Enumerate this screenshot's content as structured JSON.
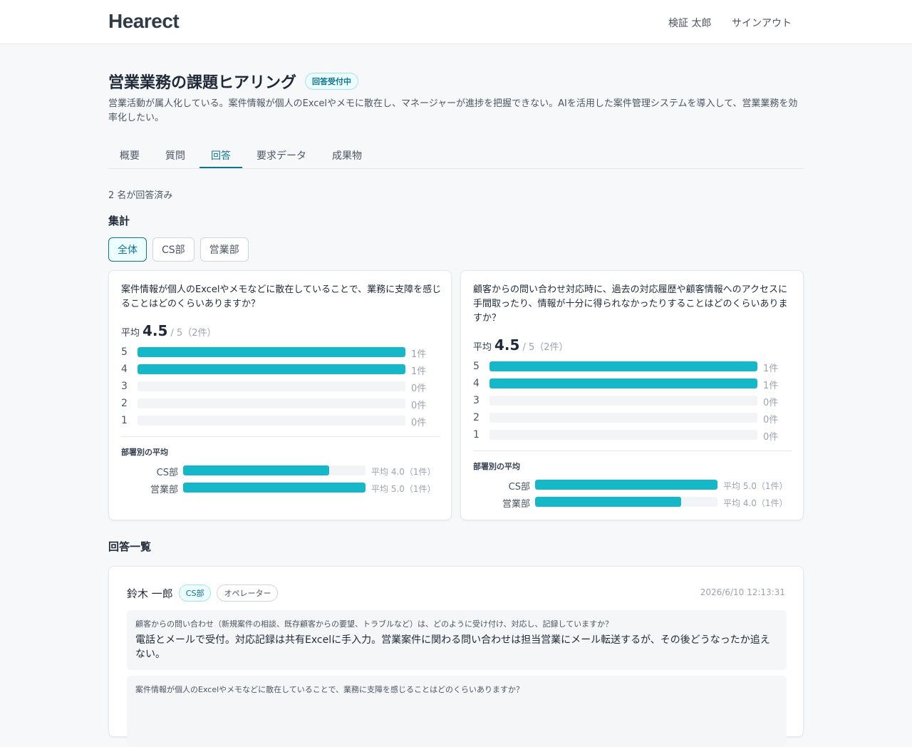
{
  "header": {
    "logo": "Hearect",
    "user_name": "検証 太郎",
    "signout_label": "サインアウト"
  },
  "project": {
    "title": "営業業務の課題ヒアリング",
    "status": "回答受付中",
    "description": "営業活動が属人化している。案件情報が個人のExcelやメモに散在し、マネージャーが進捗を把握できない。AIを活用した案件管理システムを導入して、営業業務を効率化したい。"
  },
  "tabs": [
    {
      "label": "概要"
    },
    {
      "label": "質問"
    },
    {
      "label": "回答",
      "active": true
    },
    {
      "label": "要求データ"
    },
    {
      "label": "成果物"
    }
  ],
  "respondent_count": "2 名が回答済み",
  "summary": {
    "heading": "集計",
    "filters": [
      {
        "label": "全体",
        "active": true
      },
      {
        "label": "CS部"
      },
      {
        "label": "営業部"
      }
    ]
  },
  "accent_color": "#14b8c8",
  "chart_data": [
    {
      "type": "bar",
      "title": "案件情報が個人のExcelやメモなどに散在していることで、業務に支障を感じることはどのくらいありますか？",
      "avg_label": "平均",
      "avg_value": "4.5",
      "avg_suffix": "/ 5（2件）",
      "categories": [
        "5",
        "4",
        "3",
        "2",
        "1"
      ],
      "values": [
        1,
        1,
        0,
        0,
        0
      ],
      "count_labels": [
        "1件",
        "1件",
        "0件",
        "0件",
        "0件"
      ],
      "max": 1,
      "dept_title": "部署別の平均",
      "dept": [
        {
          "name": "CS部",
          "avg": 4.0,
          "label": "平均 4.0（1件）"
        },
        {
          "name": "営業部",
          "avg": 5.0,
          "label": "平均 5.0（1件）"
        }
      ]
    },
    {
      "type": "bar",
      "title": "顧客からの問い合わせ対応時に、過去の対応履歴や顧客情報へのアクセスに手間取ったり、情報が十分に得られなかったりすることはどのくらいありますか？",
      "avg_label": "平均",
      "avg_value": "4.5",
      "avg_suffix": "/ 5（2件）",
      "categories": [
        "5",
        "4",
        "3",
        "2",
        "1"
      ],
      "values": [
        1,
        1,
        0,
        0,
        0
      ],
      "count_labels": [
        "1件",
        "1件",
        "0件",
        "0件",
        "0件"
      ],
      "max": 1,
      "dept_title": "部署別の平均",
      "dept": [
        {
          "name": "CS部",
          "avg": 5.0,
          "label": "平均 5.0（1件）"
        },
        {
          "name": "営業部",
          "avg": 4.0,
          "label": "平均 4.0（1件）"
        }
      ]
    }
  ],
  "responses": {
    "heading": "回答一覧",
    "items": [
      {
        "name": "鈴木 一郎",
        "dept": "CS部",
        "role": "オペレーター",
        "date": "2026/6/10 12:13:31",
        "qa": [
          {
            "q": "顧客からの問い合わせ（新規案件の相談、既存顧客からの要望、トラブルなど）は、どのように受け付け、対応し、記録していますか？",
            "a": "電話とメールで受付。対応記録は共有Excelに手入力。営業案件に関わる問い合わせは担当営業にメール転送するが、その後どうなったか追えない。"
          },
          {
            "q": "案件情報が個人のExcelやメモなどに散在していることで、業務に支障を感じることはどのくらいありますか？",
            "a": ""
          }
        ]
      }
    ]
  }
}
